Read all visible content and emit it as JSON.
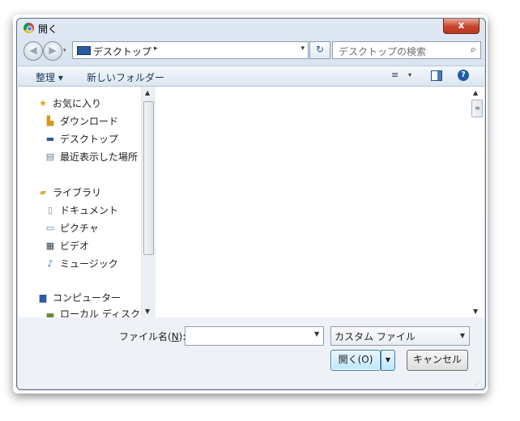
{
  "window": {
    "title": "開く",
    "close_label": "x"
  },
  "nav": {
    "back_glyph": "◀",
    "forward_glyph": "▶",
    "address": "デスクトップ",
    "address_chevron": "▸",
    "address_dropdown": "▾",
    "refresh_glyph": "↻",
    "search_placeholder": "デスクトップの検索",
    "search_icon": "⌕"
  },
  "toolbar": {
    "organize": "整理 ▾",
    "new_folder": "新しいフォルダー",
    "view_icon": "≡",
    "view_dropdown": "▾",
    "help": "?"
  },
  "sidebar": {
    "favorites_header": "お気に入り",
    "favorites": [
      "ダウンロード",
      "デスクトップ",
      "最近表示した場所"
    ],
    "libraries_header": "ライブラリ",
    "libraries": [
      "ドキュメント",
      "ピクチャ",
      "ビデオ",
      "ミュージック"
    ],
    "computer_header": "コンピューター",
    "computer": [
      "ローカル ディスク"
    ]
  },
  "footer": {
    "filename_label_prefix": "ファイル名(",
    "filename_label_key": "N",
    "filename_label_suffix": "):",
    "filename_value": "",
    "file_type": "カスタム ファイル",
    "open_label": "開く(O)",
    "cancel_label": "キャンセル"
  },
  "colors": {
    "accent": "#1e5aa8",
    "close": "#c8432a",
    "titlebar": "#dfe8f3"
  }
}
